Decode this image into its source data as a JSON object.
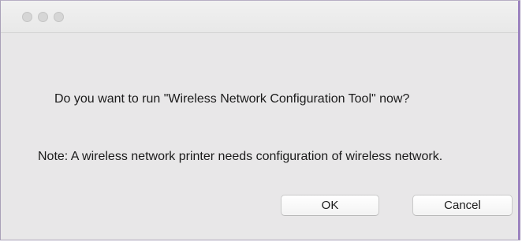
{
  "dialog": {
    "question": "Do you want to run \"Wireless Network Configuration Tool\" now?",
    "note": "Note: A wireless network printer needs configuration of wireless network.",
    "ok_label": "OK",
    "cancel_label": "Cancel"
  },
  "titlebar": {
    "buttons": [
      "close-icon",
      "minimize-icon",
      "zoom-icon"
    ],
    "button_color": "#d6d6d6"
  },
  "colors": {
    "background": "#e8e7e8",
    "window_border_accent": "#9b7fc0"
  }
}
